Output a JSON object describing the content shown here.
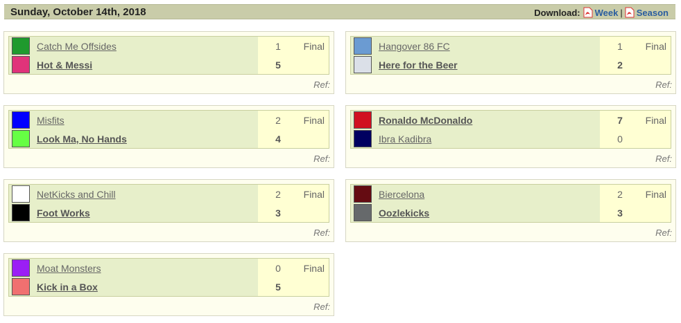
{
  "header": {
    "date": "Sunday, October 14th, 2018",
    "download_label": "Download:",
    "week_label": "Week",
    "separator": "|",
    "season_label": "Season"
  },
  "colors": {
    "link": "#2a5d9f",
    "header_bg": "#c9cca9",
    "match_bg": "#e7efca",
    "score_bg": "#ffffd3"
  },
  "games": [
    {
      "home": {
        "name": "Catch Me Offsides",
        "color": "#1f9a2e",
        "score": "1",
        "winner": false
      },
      "away": {
        "name": "Hot & Messi",
        "color": "#e0337a",
        "score": "5",
        "winner": true
      },
      "status": "Final",
      "ref": "Ref:"
    },
    {
      "home": {
        "name": "Hangover 86 FC",
        "color": "#6b9bd2",
        "score": "1",
        "winner": false
      },
      "away": {
        "name": "Here for the Beer",
        "color": "#dbe0e8",
        "score": "2",
        "winner": true
      },
      "status": "Final",
      "ref": "Ref:"
    },
    {
      "home": {
        "name": "Misfits",
        "color": "#0000ff",
        "score": "2",
        "winner": false
      },
      "away": {
        "name": "Look Ma, No Hands",
        "color": "#66ff44",
        "score": "4",
        "winner": true
      },
      "status": "Final",
      "ref": "Ref:"
    },
    {
      "home": {
        "name": "Ronaldo McDonaldo",
        "color": "#d01020",
        "score": "7",
        "winner": true
      },
      "away": {
        "name": "Ibra Kadibra",
        "color": "#000060",
        "score": "0",
        "winner": false
      },
      "status": "Final",
      "ref": "Ref:"
    },
    {
      "home": {
        "name": "NetKicks and Chill",
        "color": "#ffffff",
        "score": "2",
        "winner": false
      },
      "away": {
        "name": "Foot Works",
        "color": "#000000",
        "score": "3",
        "winner": true
      },
      "status": "Final",
      "ref": "Ref:"
    },
    {
      "home": {
        "name": "Biercelona",
        "color": "#650c12",
        "score": "2",
        "winner": false
      },
      "away": {
        "name": "Oozlekicks",
        "color": "#66696b",
        "score": "3",
        "winner": true
      },
      "status": "Final",
      "ref": "Ref:"
    },
    {
      "home": {
        "name": "Moat Monsters",
        "color": "#9b1ff5",
        "score": "0",
        "winner": false
      },
      "away": {
        "name": "Kick in a Box",
        "color": "#f07070",
        "score": "5",
        "winner": true
      },
      "status": "Final",
      "ref": "Ref:"
    }
  ]
}
